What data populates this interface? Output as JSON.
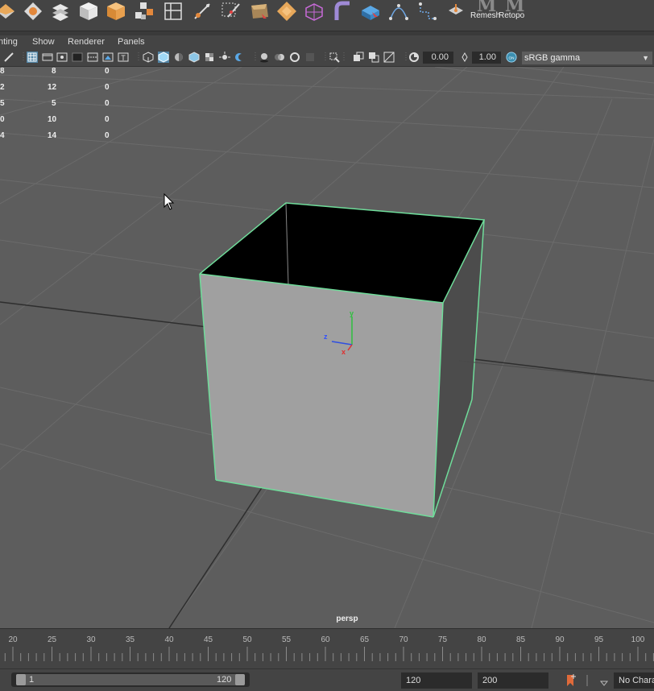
{
  "shelf": {
    "icons": [
      "poly-sphere-icon",
      "poly-plane-icon",
      "poly-type-icon",
      "cube-icon",
      "cylinder-icon",
      "combine-icon",
      "multi-cut-icon",
      "target-weld-icon",
      "quad-draw-icon",
      "bevel-icon",
      "extrude-icon",
      "bridge-icon",
      "smooth-icon",
      "mirror-icon",
      "curve-icon",
      "path-icon",
      "soft-select-icon"
    ],
    "text_buttons": [
      {
        "label": "Remesh",
        "glyph": "M"
      },
      {
        "label": "Retopo",
        "glyph": "M"
      }
    ]
  },
  "panel_menu": [
    "nting",
    "Show",
    "Renderer",
    "Panels"
  ],
  "panel_toolbar": {
    "exposure_value": "0.00",
    "gamma_value": "1.00",
    "color_space": "sRGB gamma",
    "accent_color": "#5285a6"
  },
  "hud": {
    "rows": [
      {
        "a": "8",
        "b": "8",
        "c": "0"
      },
      {
        "a": "2",
        "b": "12",
        "c": "0"
      },
      {
        "a": "5",
        "b": "5",
        "c": "0"
      },
      {
        "a": "0",
        "b": "10",
        "c": "0"
      },
      {
        "a": "4",
        "b": "14",
        "c": "0"
      }
    ]
  },
  "viewport": {
    "camera_label": "persp",
    "selection_color": "#6fdc9a",
    "axis_labels": {
      "x": "x",
      "y": "y",
      "z": "z"
    }
  },
  "time_slider": {
    "tick_labels": [
      "20",
      "25",
      "30",
      "35",
      "40",
      "45",
      "50",
      "55",
      "60",
      "65",
      "70",
      "75",
      "80",
      "85",
      "90",
      "95",
      "100"
    ],
    "start": 20,
    "end": 100
  },
  "range_slider": {
    "range_start": "1",
    "range_end": "120",
    "playback_end": "120",
    "animation_end": "200",
    "character_set": "No Character Set"
  }
}
